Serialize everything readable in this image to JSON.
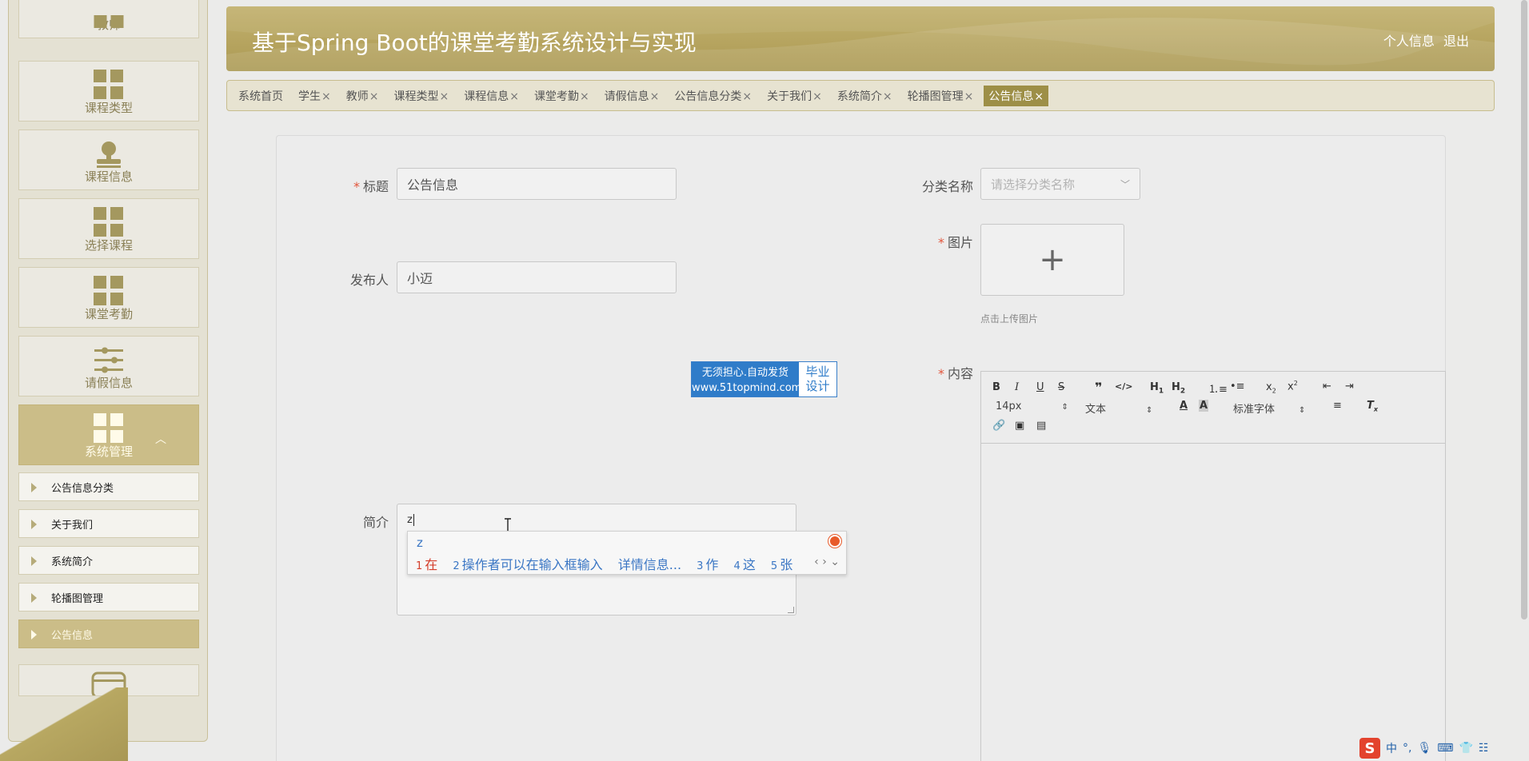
{
  "sidebar": {
    "blocks": [
      {
        "label": "教师"
      },
      {
        "label": "课程类型"
      },
      {
        "label": "课程信息"
      },
      {
        "label": "选择课程"
      },
      {
        "label": "课堂考勤"
      },
      {
        "label": "请假信息"
      },
      {
        "label": "系统管理"
      }
    ],
    "sub_items": [
      {
        "label": "公告信息分类"
      },
      {
        "label": "关于我们"
      },
      {
        "label": "系统简介"
      },
      {
        "label": "轮播图管理"
      },
      {
        "label": "公告信息"
      }
    ]
  },
  "header": {
    "title": "基于Spring Boot的课堂考勤系统设计与实现",
    "profile": "个人信息",
    "logout": "退出"
  },
  "tabs": [
    {
      "label": "系统首页",
      "closable": false
    },
    {
      "label": "学生",
      "closable": true
    },
    {
      "label": "教师",
      "closable": true
    },
    {
      "label": "课程类型",
      "closable": true
    },
    {
      "label": "课程信息",
      "closable": true
    },
    {
      "label": "课堂考勤",
      "closable": true
    },
    {
      "label": "请假信息",
      "closable": true
    },
    {
      "label": "公告信息分类",
      "closable": true
    },
    {
      "label": "关于我们",
      "closable": true
    },
    {
      "label": "系统简介",
      "closable": true
    },
    {
      "label": "轮播图管理",
      "closable": true
    },
    {
      "label": "公告信息",
      "closable": true,
      "active": true
    }
  ],
  "close_glyph": "×",
  "required_mark": "*",
  "form": {
    "title_label": "标题",
    "title_value": "公告信息",
    "category_label": "分类名称",
    "category_placeholder": "请选择分类名称",
    "publisher_label": "发布人",
    "publisher_value": "小迈",
    "image_label": "图片",
    "upload_plus": "+",
    "upload_hint": "点击上传图片",
    "content_label": "内容",
    "summary_label": "简介",
    "summary_value": "z"
  },
  "ad": {
    "line1": "无须担心.自动发货",
    "line2": "www.51topmind.com",
    "right1": "毕业",
    "right2": "设计"
  },
  "ime": {
    "typed": "z",
    "candidates": [
      {
        "n": "1",
        "text": "在"
      },
      {
        "n": "2",
        "text": "操作者可以在输入框输入"
      },
      {
        "n": "",
        "text": "详情信息..."
      },
      {
        "n": "3",
        "text": "作"
      },
      {
        "n": "4",
        "text": "这"
      },
      {
        "n": "5",
        "text": "张"
      }
    ],
    "nav": "‹ › ⌄"
  },
  "editor": {
    "font_size": "14px",
    "block_type": "文本",
    "font_family": "标准字体"
  },
  "tray": {
    "logo": "S",
    "lang": "中",
    "punct": "°,"
  }
}
